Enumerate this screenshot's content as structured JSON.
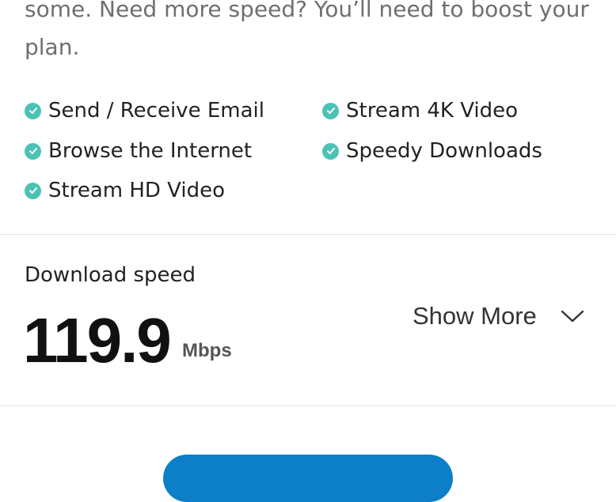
{
  "intro": {
    "text": "some. Need more speed? You’ll need to boost your plan."
  },
  "features": {
    "items": [
      {
        "label": "Send / Receive Email",
        "icon": "check-circle-icon"
      },
      {
        "label": "Browse the Internet",
        "icon": "check-circle-icon"
      },
      {
        "label": "Stream HD Video",
        "icon": "check-circle-icon"
      },
      {
        "label": "Stream 4K Video",
        "icon": "check-circle-icon"
      },
      {
        "label": "Speedy Downloads",
        "icon": "check-circle-icon"
      }
    ]
  },
  "speed": {
    "label": "Download speed",
    "value": "119.9",
    "unit": "Mbps"
  },
  "show_more": {
    "label": "Show More",
    "icon": "chevron-down-icon"
  },
  "colors": {
    "accent_check": "#4cc2b6",
    "button_blue": "#0d7fc8"
  }
}
